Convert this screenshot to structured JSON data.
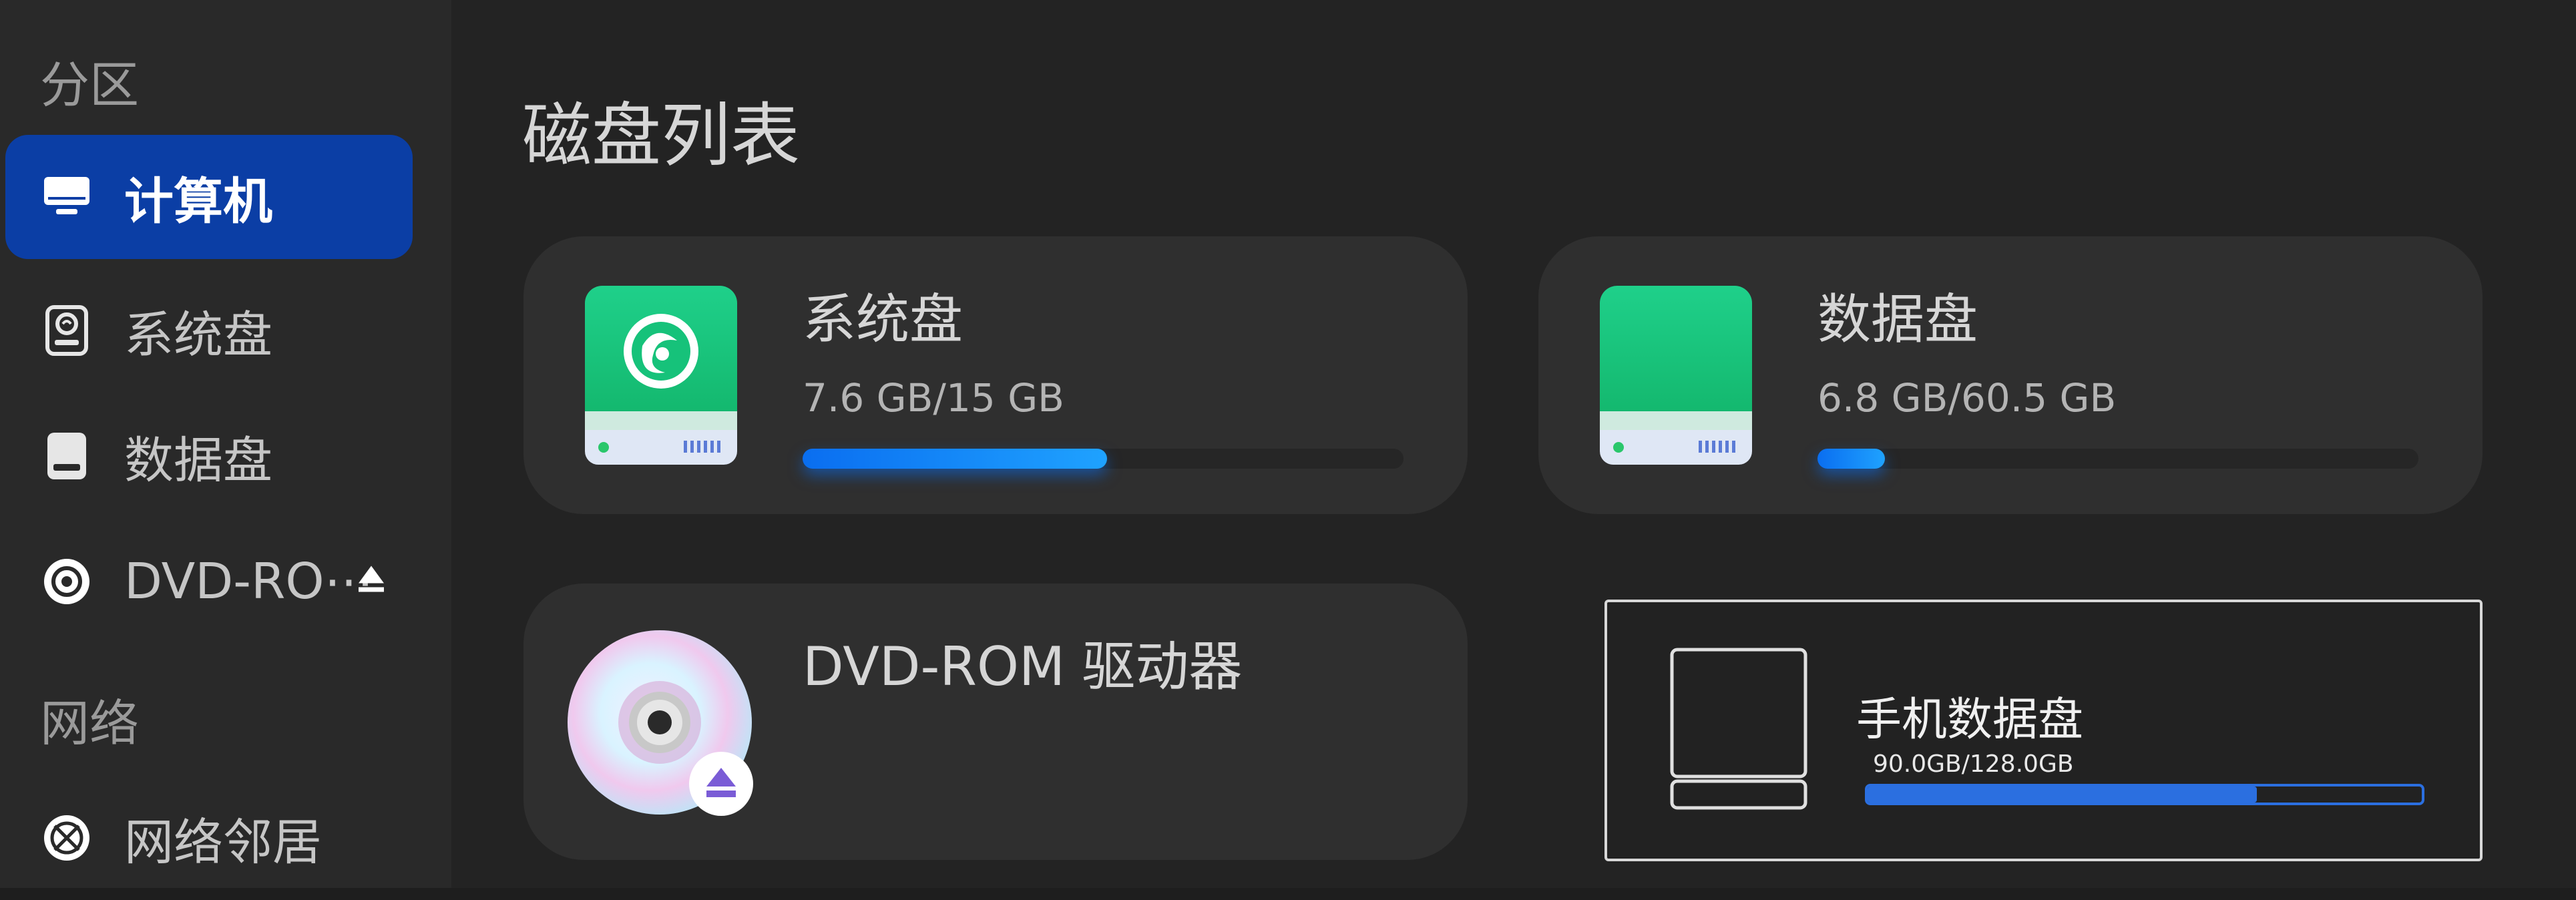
{
  "sidebar": {
    "sections": {
      "partitions": "分区",
      "network": "网络"
    },
    "items": [
      {
        "label": "计算机",
        "icon": "computer-icon",
        "active": true
      },
      {
        "label": "系统盘",
        "icon": "system-disk-icon",
        "active": false
      },
      {
        "label": "数据盘",
        "icon": "data-disk-icon",
        "active": false
      },
      {
        "label": "DVD-RO⋯",
        "icon": "dvd-icon",
        "active": false,
        "eject": "eject-icon"
      },
      {
        "label": "网络邻居",
        "icon": "network-neighbors-icon",
        "active": false
      }
    ]
  },
  "main": {
    "title": "磁盘列表",
    "disks": [
      {
        "name": "系统盘",
        "usage": "7.6 GB/15 GB",
        "fill": 0.5067,
        "icon": "deepin-system-drive-icon"
      },
      {
        "name": "数据盘",
        "usage": "6.8 GB/60.5 GB",
        "fill": 0.1124,
        "icon": "data-drive-icon"
      },
      {
        "name": "DVD-ROM 驱动器",
        "icon": "dvd-disc-icon"
      }
    ],
    "phone": {
      "name": "手机数据盘",
      "usage": "90.0GB/128.0GB",
      "fill": 0.703,
      "icon": "phone-drive-outline-icon"
    }
  },
  "colors": {
    "accent": "#0b3ea5",
    "bar": "#1a8cff",
    "drive_green": "#17c07a",
    "background": "#232323"
  }
}
